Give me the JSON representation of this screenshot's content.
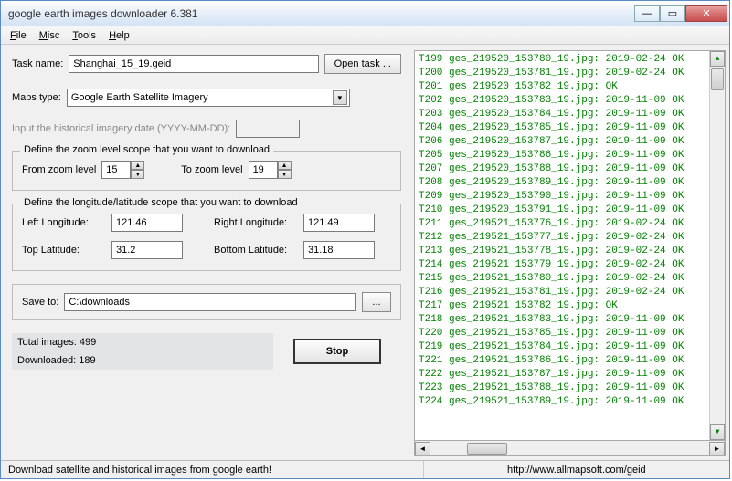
{
  "window": {
    "title": "google earth images downloader 6.381"
  },
  "menu": {
    "file": "File",
    "misc": "Misc",
    "tools": "Tools",
    "help": "Help"
  },
  "task": {
    "label": "Task name:",
    "value": "Shanghai_15_19.geid",
    "open_btn": "Open task ..."
  },
  "maps": {
    "label": "Maps type:",
    "value": "Google Earth Satellite Imagery"
  },
  "historical": {
    "label": "Input the  historical imagery date (YYYY-MM-DD):",
    "value": ""
  },
  "zoom": {
    "legend": "Define the zoom level scope that you want to download",
    "from_label": "From zoom level",
    "from_value": "15",
    "to_label": "To zoom level",
    "to_value": "19"
  },
  "coords": {
    "legend": "Define the longitude/latitude scope that you want to download",
    "left_label": "Left Longitude:",
    "left_value": "121.46",
    "right_label": "Right Longitude:",
    "right_value": "121.49",
    "top_label": "Top Latitude:",
    "top_value": "31.2",
    "bottom_label": "Bottom Latitude:",
    "bottom_value": "31.18"
  },
  "save": {
    "label": "Save to:",
    "value": "C:\\downloads",
    "browse": "..."
  },
  "stats": {
    "total_label": "Total images: ",
    "total_value": "499",
    "down_label": "Downloaded: ",
    "down_value": "189"
  },
  "action": {
    "stop": "Stop"
  },
  "status": {
    "left": "Download satellite and historical  images from google earth!",
    "right": "http://www.allmapsoft.com/geid"
  },
  "log": [
    "T199 ges_219520_153780_19.jpg: 2019-02-24 OK",
    "T200 ges_219520_153781_19.jpg: 2019-02-24 OK",
    "T201 ges_219520_153782_19.jpg:  OK",
    "T202 ges_219520_153783_19.jpg: 2019-11-09 OK",
    "T203 ges_219520_153784_19.jpg: 2019-11-09 OK",
    "T204 ges_219520_153785_19.jpg: 2019-11-09 OK",
    "T206 ges_219520_153787_19.jpg: 2019-11-09 OK",
    "T205 ges_219520_153786_19.jpg: 2019-11-09 OK",
    "T207 ges_219520_153788_19.jpg: 2019-11-09 OK",
    "T208 ges_219520_153789_19.jpg: 2019-11-09 OK",
    "T209 ges_219520_153790_19.jpg: 2019-11-09 OK",
    "T210 ges_219520_153791_19.jpg: 2019-11-09 OK",
    "T211 ges_219521_153776_19.jpg: 2019-02-24 OK",
    "T212 ges_219521_153777_19.jpg: 2019-02-24 OK",
    "T213 ges_219521_153778_19.jpg: 2019-02-24 OK",
    "T214 ges_219521_153779_19.jpg: 2019-02-24 OK",
    "T215 ges_219521_153780_19.jpg: 2019-02-24 OK",
    "T216 ges_219521_153781_19.jpg: 2019-02-24 OK",
    "T217 ges_219521_153782_19.jpg:  OK",
    "T218 ges_219521_153783_19.jpg: 2019-11-09 OK",
    "T220 ges_219521_153785_19.jpg: 2019-11-09 OK",
    "T219 ges_219521_153784_19.jpg: 2019-11-09 OK",
    "T221 ges_219521_153786_19.jpg: 2019-11-09 OK",
    "T222 ges_219521_153787_19.jpg: 2019-11-09 OK",
    "T223 ges_219521_153788_19.jpg: 2019-11-09 OK",
    "T224 ges_219521_153789_19.jpg: 2019-11-09 OK"
  ]
}
